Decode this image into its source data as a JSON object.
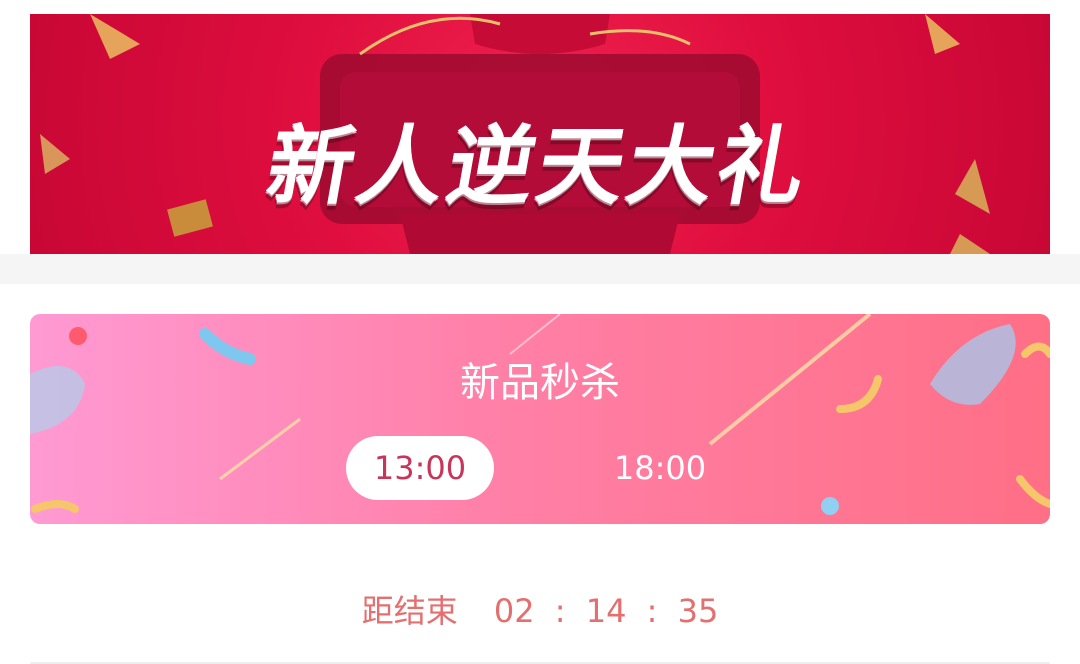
{
  "promo_banner": {
    "title": "新人逆天大礼"
  },
  "flash_sale": {
    "title": "新品秒杀",
    "tabs": [
      {
        "label": "13:00",
        "active": true
      },
      {
        "label": "18:00",
        "active": false
      }
    ]
  },
  "countdown": {
    "label": "距结束",
    "hours": "02",
    "minutes": "14",
    "seconds": "35",
    "separator": ":"
  },
  "colors": {
    "banner_red": "#df0e3e",
    "card_pink": "#ff80a8",
    "countdown_text": "#e36f6f",
    "active_tab_text": "#c7355a"
  }
}
